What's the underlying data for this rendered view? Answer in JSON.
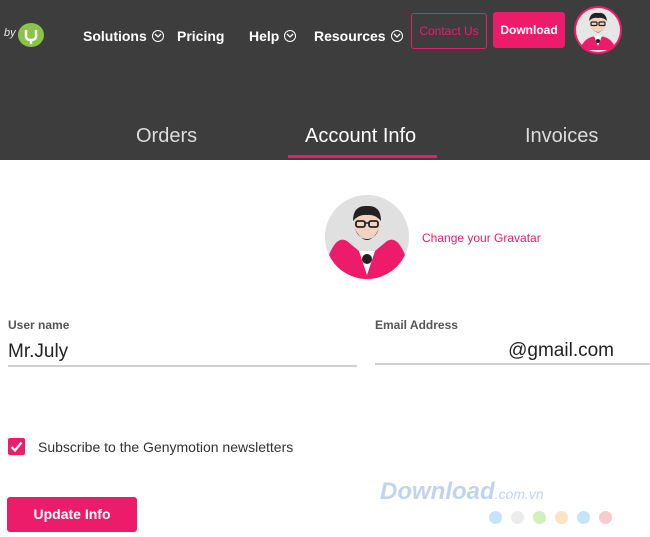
{
  "brand": {
    "by_text": "by"
  },
  "nav": {
    "items": [
      {
        "label": "Solutions",
        "has_dropdown": true
      },
      {
        "label": "Pricing",
        "has_dropdown": false
      },
      {
        "label": "Help",
        "has_dropdown": true
      },
      {
        "label": "Resources",
        "has_dropdown": true
      }
    ],
    "contact_label": "Contact Us",
    "download_label": "Download"
  },
  "tabs": [
    {
      "label": "Orders",
      "active": false
    },
    {
      "label": "Account Info",
      "active": true
    },
    {
      "label": "Invoices",
      "active": false
    }
  ],
  "profile": {
    "change_gravatar_label": "Change your Gravatar",
    "username": {
      "label": "User name",
      "value": "Mr.July"
    },
    "email": {
      "label": "Email Address",
      "value": "@gmail.com"
    },
    "newsletter": {
      "label": "Subscribe to the Genymotion newsletters",
      "checked": true
    },
    "update_button_label": "Update Info"
  },
  "watermark": {
    "text": "Download",
    "suffix": ".com.vn"
  },
  "colors": {
    "accent": "#ec1c6b",
    "header_bg": "#3d3d3d",
    "logo_green": "#8bc34a"
  }
}
